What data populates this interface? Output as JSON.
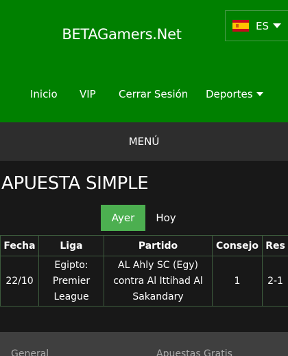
{
  "header": {
    "site_title": "BETAGamers.Net",
    "language": {
      "code": "ES",
      "flag_icon": "spain-flag-icon"
    }
  },
  "nav": {
    "items": [
      {
        "label": "Inicio"
      },
      {
        "label": "VIP"
      },
      {
        "label": "Cerrar Sesión"
      },
      {
        "label": "Deportes",
        "has_dropdown": true
      }
    ]
  },
  "menu_bar": {
    "label": "MENÚ"
  },
  "page": {
    "title": "APUESTA SIMPLE",
    "tabs": [
      {
        "label": "Ayer",
        "active": true
      },
      {
        "label": "Hoy",
        "active": false
      }
    ]
  },
  "table": {
    "headers": [
      "Fecha",
      "Liga",
      "Partido",
      "Consejo",
      "Res"
    ],
    "rows": [
      {
        "fecha": "22/10",
        "liga": "Egipto: Premier League",
        "partido": "AL Ahly SC (Egy) contra Al Ittihad Al Sakandary",
        "consejo": "1",
        "res": "2-1"
      }
    ]
  },
  "footer": {
    "items": [
      {
        "label": "General"
      },
      {
        "label": "Apuestas Gratis"
      }
    ]
  },
  "colors": {
    "header_green": "#008000",
    "active_tab": "#4caf50",
    "menu_bar": "#2d2d2d",
    "background": "#181818",
    "footer": "#3f3f3f"
  }
}
